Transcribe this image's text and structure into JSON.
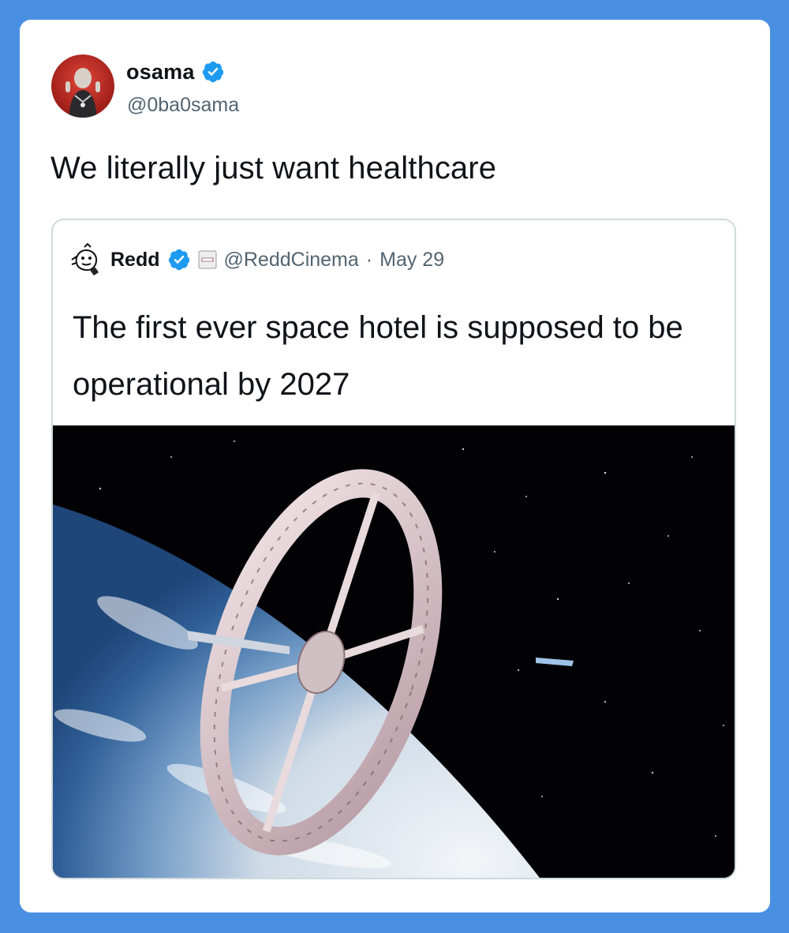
{
  "tweet": {
    "author_name": "osama",
    "author_handle": "@0ba0sama",
    "verified": true,
    "text": "We literally just want healthcare"
  },
  "quoted_tweet": {
    "author_name": "Redd",
    "verified": true,
    "handle": "@ReddCinema",
    "separator": "·",
    "date": "May 29",
    "text": "The first ever space hotel is supposed to be operational by 2027",
    "media_description_icon": "space-station-image"
  },
  "colors": {
    "background": "#4a90e2",
    "verified_blue": "#1d9bf0",
    "text_primary": "#0f1419",
    "text_secondary": "#536471"
  }
}
